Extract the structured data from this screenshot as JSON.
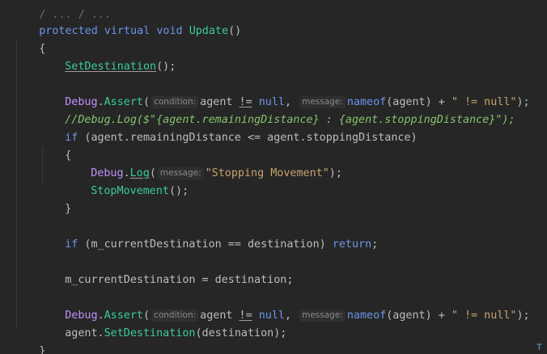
{
  "editor": {
    "top_fragment": "/ ... / ...",
    "lines": {
      "l1": {
        "kw1": "protected",
        "kw2": "virtual",
        "kw3": "void",
        "fn": "Update",
        "rest": "()"
      },
      "l2": {
        "text": "{"
      },
      "l3": {
        "fn": "SetDestination",
        "rest": "();"
      },
      "l5": {
        "cls": "Debug",
        "dot": ".",
        "fn": "Assert",
        "open": "(",
        "hint1": "condition:",
        "a1": "agent",
        "op": "!=",
        "kwnull": "null",
        "comma": ",",
        "hint2": "message:",
        "fn2": "nameof",
        "a2": "(agent) + ",
        "str": "\" != null\"",
        "close": ");"
      },
      "l6": {
        "text": "//Debug.Log($\"{agent.remainingDistance} : {agent.stoppingDistance}\");"
      },
      "l7": {
        "kw": "if",
        "rest": " (agent.remainingDistance <= agent.stoppingDistance)"
      },
      "l8": {
        "text": "{"
      },
      "l9": {
        "cls": "Debug",
        "dot": ".",
        "fn": "Log",
        "open": "(",
        "hint": "message:",
        "str": "\"Stopping Movement\"",
        "close": ");"
      },
      "l10": {
        "fn": "StopMovement",
        "rest": "();"
      },
      "l11": {
        "text": "}"
      },
      "l13": {
        "kw": "if",
        "mid": " (m_currentDestination == destination) ",
        "kw2": "return",
        "rest": ";"
      },
      "l15": {
        "text": "m_currentDestination = destination;"
      },
      "l17": {
        "cls": "Debug",
        "dot": ".",
        "fn": "Assert",
        "open": "(",
        "hint1": "condition:",
        "a1": "agent",
        "op": "!=",
        "kwnull": "null",
        "comma": ",",
        "hint2": "message:",
        "fn2": "nameof",
        "a2": "(agent) + ",
        "str": "\" != null\"",
        "close": ");"
      },
      "l18": {
        "a": "agent.",
        "fn": "SetDestination",
        "rest": "(destination);"
      },
      "l19": {
        "text": "}"
      }
    },
    "cursor_glyph": "⊤"
  },
  "colors": {
    "background": "#262626",
    "keyword": "#6c95eb",
    "method": "#39cc9b",
    "type": "#c191ff",
    "string": "#c9a26d",
    "comment": "#85c46c",
    "text": "#bdbdbd"
  }
}
